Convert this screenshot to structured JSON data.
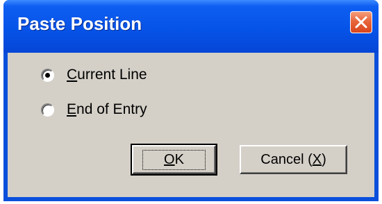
{
  "window": {
    "title": "Paste Position"
  },
  "options": [
    {
      "label_first": "C",
      "label_rest": "urrent Line",
      "selected": true
    },
    {
      "label_first": "E",
      "label_rest": "nd of Entry",
      "selected": false
    }
  ],
  "buttons": {
    "ok": {
      "label_first": "O",
      "label_rest": "K"
    },
    "cancel": {
      "label_pre": "Cancel (",
      "label_key": "X",
      "label_post": ")"
    }
  },
  "colors": {
    "titlebar": "#0652e6",
    "client": "#d4d0c8",
    "close": "#e8663c"
  },
  "icons": {
    "close": "close-icon"
  }
}
